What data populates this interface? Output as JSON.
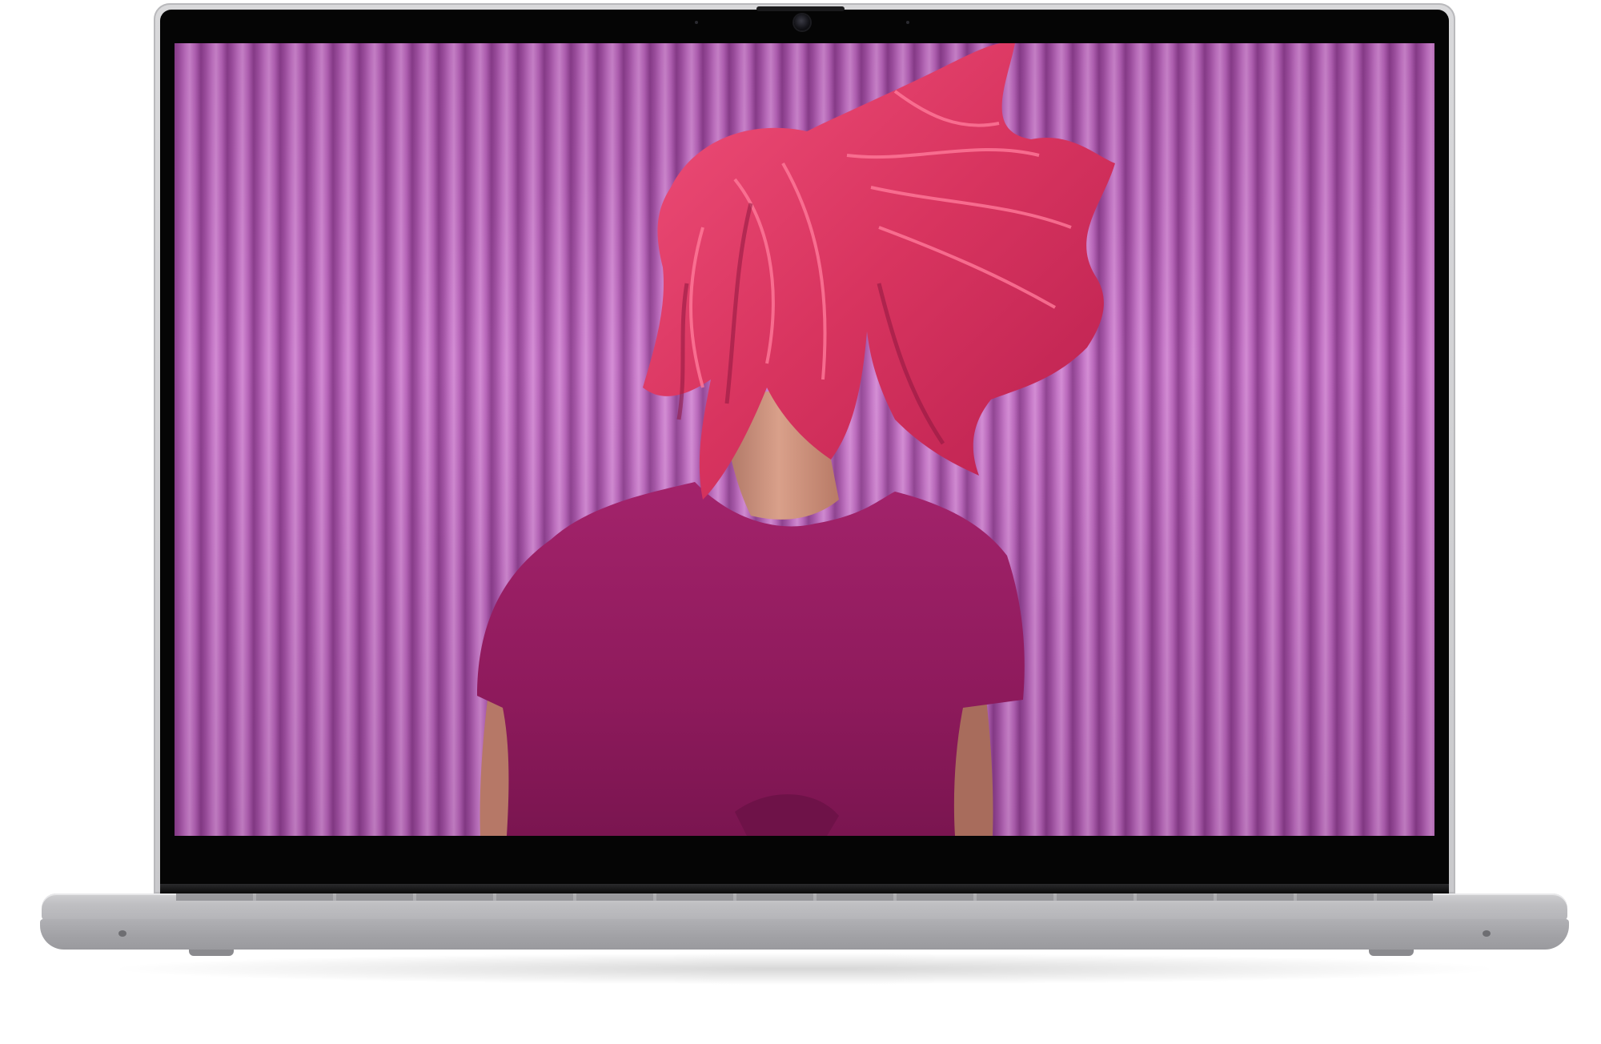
{
  "image": {
    "subject": "laptop",
    "screen_content": "photo",
    "colors": {
      "wall": "#b060b0",
      "hair": "#e0406a",
      "shirt": "#9a1c63",
      "skin": "#c98f7a",
      "chassis": "#c6c6c9",
      "bezel": "#050505"
    }
  }
}
